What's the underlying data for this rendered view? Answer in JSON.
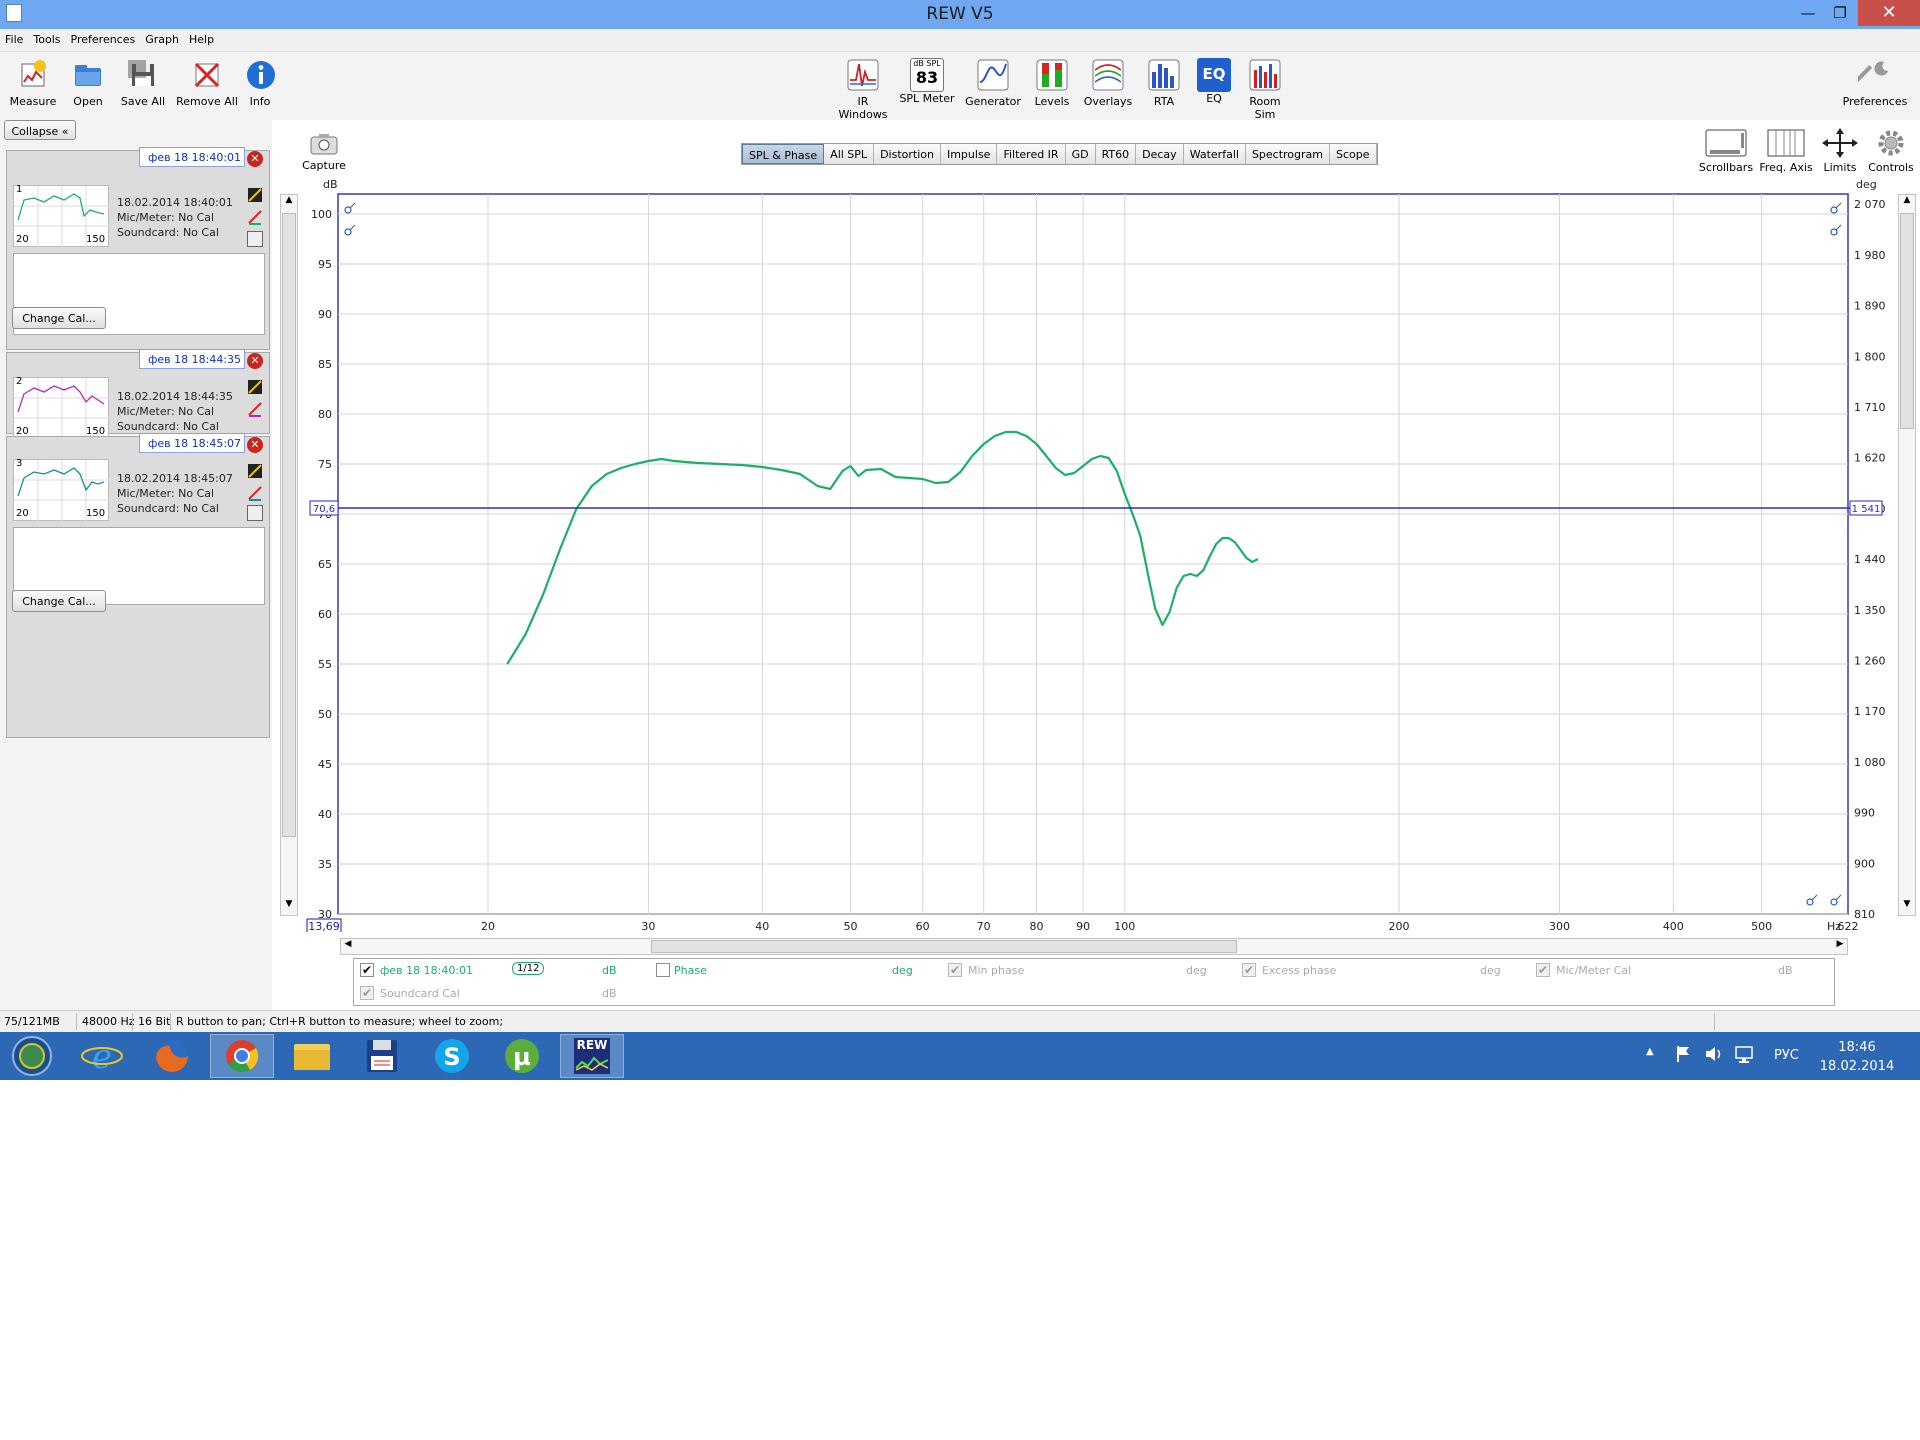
{
  "window": {
    "title": "REW V5",
    "minimize": "—",
    "maximize": "❐",
    "close": "✕"
  },
  "menu": [
    "File",
    "Tools",
    "Preferences",
    "Graph",
    "Help"
  ],
  "toolbar_left": [
    {
      "label": "Measure",
      "icon": "measure-icon"
    },
    {
      "label": "Open",
      "icon": "folder-icon"
    },
    {
      "label": "Save All",
      "icon": "floppy-icon"
    },
    {
      "label": "Remove All",
      "icon": "remove-all-icon"
    },
    {
      "label": "Info",
      "icon": "info-icon"
    }
  ],
  "toolbar_center": [
    {
      "label": "IR Windows",
      "icon": "ir-windows-icon"
    },
    {
      "label": "SPL Meter",
      "icon": "spl-meter-icon",
      "badge_top": "dB SPL",
      "badge_value": "83"
    },
    {
      "label": "Generator",
      "icon": "generator-icon"
    },
    {
      "label": "Levels",
      "icon": "levels-icon"
    },
    {
      "label": "Overlays",
      "icon": "overlays-icon"
    },
    {
      "label": "RTA",
      "icon": "rta-icon"
    },
    {
      "label": "EQ",
      "icon": "eq-icon",
      "badge_value": "EQ"
    },
    {
      "label": "Room Sim",
      "icon": "room-sim-icon"
    }
  ],
  "toolbar_right": {
    "label": "Preferences",
    "icon": "wrench-icon"
  },
  "left_panel": {
    "collapse_label": "Collapse",
    "measurements": [
      {
        "num": "1",
        "name": "фев 18 18:40:01",
        "date": "18.02.2014 18:40:01",
        "mic": "Mic/Meter: No Cal",
        "sound": "Soundcard: No Cal",
        "thumb_min": "20",
        "thumb_max": "150",
        "color": "#1bb066",
        "change_cal": "Change Cal..."
      },
      {
        "num": "2",
        "name": "фев 18 18:44:35",
        "date": "18.02.2014 18:44:35",
        "mic": "Mic/Meter: No Cal",
        "sound": "Soundcard: No Cal",
        "thumb_min": "20",
        "thumb_max": "150",
        "color": "#b52ab5"
      },
      {
        "num": "3",
        "name": "фев 18 18:45:07",
        "date": "18.02.2014 18:45:07",
        "mic": "Mic/Meter: No Cal",
        "sound": "Soundcard: No Cal",
        "thumb_min": "20",
        "thumb_max": "150",
        "color": "#1a8f8f",
        "change_cal": "Change Cal..."
      }
    ]
  },
  "capture": {
    "label": "Capture",
    "icon": "camera-icon"
  },
  "graph_tabs": [
    "SPL & Phase",
    "All SPL",
    "Distortion",
    "Impulse",
    "Filtered IR",
    "GD",
    "RT60",
    "Decay",
    "Waterfall",
    "Spectrogram",
    "Scope"
  ],
  "graph_tabs_active": "SPL & Phase",
  "graph_tools": [
    {
      "label": "Scrollbars",
      "icon": "scrollbars-icon"
    },
    {
      "label": "Freq. Axis",
      "icon": "freq-axis-icon"
    },
    {
      "label": "Limits",
      "icon": "limits-icon"
    },
    {
      "label": "Controls",
      "icon": "gear-icon"
    }
  ],
  "chart_data": {
    "type": "line",
    "left_unit": "dB",
    "right_unit": "deg",
    "x_unit": "Hz",
    "x_scale": "log",
    "xlim": [
      13.69,
      622
    ],
    "ylim": [
      30,
      102
    ],
    "right_ylim": [
      810,
      2088
    ],
    "x_ticks": [
      20,
      30,
      40,
      50,
      60,
      70,
      80,
      90,
      100,
      200,
      300,
      400,
      500
    ],
    "x_tick_labels": [
      "20",
      "30",
      "40",
      "50",
      "60",
      "70",
      "80",
      "90",
      "100",
      "200",
      "300",
      "400",
      "500"
    ],
    "x_min_label": "13,69",
    "x_max_label": "622",
    "y_ticks": [
      30,
      35,
      40,
      45,
      50,
      55,
      60,
      65,
      70,
      75,
      80,
      85,
      90,
      95,
      100
    ],
    "y_tick_labels": [
      "30",
      "35",
      "40",
      "45",
      "50",
      "55",
      "60",
      "65",
      "70",
      "75",
      "80",
      "85",
      "90",
      "95",
      "100"
    ],
    "right_ticks": [
      810,
      900,
      990,
      1080,
      1170,
      1260,
      1350,
      1440,
      1530,
      1620,
      1710,
      1800,
      1890,
      1980,
      2070
    ],
    "right_tick_labels": [
      "810",
      "900",
      "990",
      "1 080",
      "1 170",
      "1 260",
      "1 350",
      "1 440",
      "1 530",
      "1 620",
      "1 710",
      "1 800",
      "1 890",
      "1 980",
      "2 070"
    ],
    "cursor_left_label": "70,6",
    "cursor_right_label": "1 541",
    "cursor_value": 70.6,
    "grid": true,
    "series": [
      {
        "color": "#1bb066",
        "x": [
          21,
          22,
          23,
          24,
          25,
          26,
          27,
          28,
          29,
          30,
          31,
          32,
          34,
          36,
          38,
          40,
          42,
          44,
          46,
          47.5,
          49,
          50,
          51,
          52,
          54,
          56,
          58,
          60,
          62,
          64,
          66,
          68,
          70,
          72,
          74,
          76,
          78,
          80,
          82,
          84,
          86,
          88,
          90,
          92,
          94,
          96,
          98,
          100,
          102,
          104,
          106,
          108,
          110,
          112,
          114,
          116,
          118,
          120,
          122,
          124,
          126,
          128,
          130,
          132,
          134,
          136,
          138,
          140
        ],
        "y": [
          55,
          58,
          62,
          66.5,
          70.5,
          72.8,
          74.0,
          74.6,
          75.0,
          75.3,
          75.5,
          75.3,
          75.1,
          75.0,
          74.9,
          74.7,
          74.4,
          74.0,
          72.8,
          72.5,
          74.3,
          74.8,
          73.8,
          74.4,
          74.5,
          73.7,
          73.6,
          73.5,
          73.1,
          73.2,
          74.2,
          75.8,
          77.0,
          77.8,
          78.2,
          78.2,
          77.8,
          77.0,
          75.8,
          74.6,
          73.9,
          74.1,
          74.8,
          75.5,
          75.8,
          75.6,
          74.3,
          72.0,
          70.0,
          67.8,
          64.0,
          60.5,
          58.9,
          60.2,
          62.6,
          63.8,
          64.0,
          63.8,
          64.4,
          65.8,
          67.0,
          67.6,
          67.6,
          67.2,
          66.4,
          65.6,
          65.2,
          65.5
        ]
      }
    ]
  },
  "legend": {
    "row1": [
      {
        "checked": true,
        "label": "фев 18 18:40:01",
        "smoothing": "1/12",
        "unit": "dB"
      },
      {
        "checked": false,
        "label": "Phase",
        "unit": "deg"
      },
      {
        "checked": true,
        "disabled": true,
        "label": "Min phase",
        "unit": "deg"
      },
      {
        "checked": true,
        "disabled": true,
        "label": "Excess phase",
        "unit": "deg"
      },
      {
        "checked": true,
        "disabled": true,
        "label": "Mic/Meter Cal",
        "unit": "dB"
      }
    ],
    "row2": [
      {
        "checked": true,
        "disabled": true,
        "label": "Soundcard Cal",
        "unit": "dB"
      }
    ]
  },
  "status": {
    "memory": "75/121MB",
    "rate": "48000 Hz",
    "bits": "16 Bit",
    "hint": "R button to pan; Ctrl+R button to measure; wheel to zoom;"
  },
  "taskbar": {
    "apps": [
      "start-orb-icon",
      "ie-icon",
      "firefox-icon",
      "chrome-icon",
      "explorer-icon",
      "floppy-app-icon",
      "skype-icon",
      "utorrent-icon",
      "rew-icon"
    ],
    "active": [
      "chrome-icon",
      "rew-icon"
    ],
    "rew_badge": "REW",
    "lang": "РУС",
    "time": "18:46",
    "date": "18.02.2014"
  }
}
